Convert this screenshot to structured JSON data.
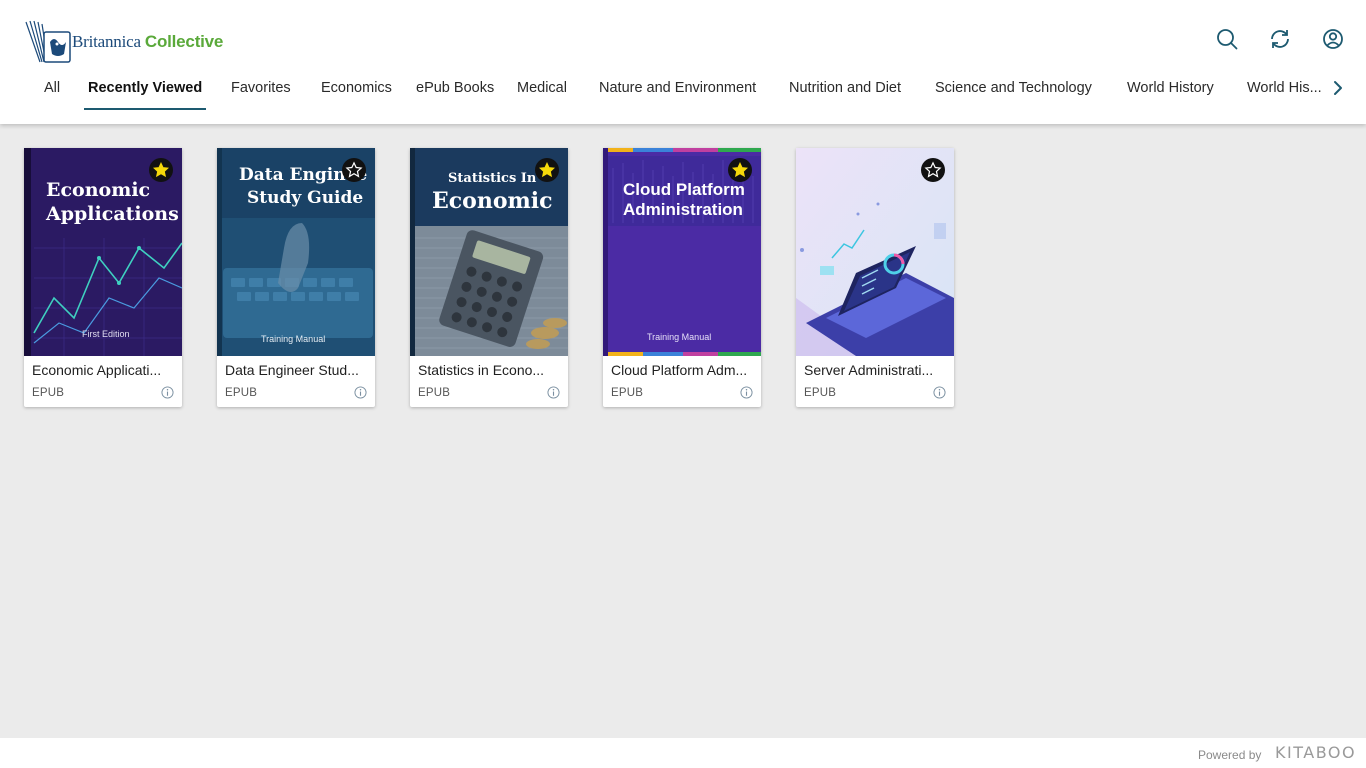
{
  "brand": {
    "name_primary": "Britannica",
    "name_accent": "Collective",
    "accent_color": "#5aa93a",
    "primary_color": "#1c4a7a"
  },
  "header_icons": [
    "search-icon",
    "refresh-icon",
    "account-icon"
  ],
  "tabs": [
    {
      "label": "All"
    },
    {
      "label": "Recently Viewed",
      "active": true
    },
    {
      "label": "Favorites"
    },
    {
      "label": "Economics"
    },
    {
      "label": "ePub Books"
    },
    {
      "label": "Medical"
    },
    {
      "label": "Nature and Environment"
    },
    {
      "label": "Nutrition and Diet"
    },
    {
      "label": "Science and Technology"
    },
    {
      "label": "World History"
    },
    {
      "label": "World His..."
    }
  ],
  "books": [
    {
      "title": "Economic Applicati...",
      "format": "EPUB",
      "favorite": true,
      "cover": {
        "line1": "Economic",
        "line2": "Applications",
        "footer": "First Edition",
        "bg": "#2b1a63"
      }
    },
    {
      "title": "Data Engineer Stud...",
      "format": "EPUB",
      "favorite": false,
      "cover": {
        "line1": "Data Enginee",
        "line2": "Study Guide",
        "footer": "Training Manual",
        "bg": "#1f4f74"
      }
    },
    {
      "title": "Statistics in Econo...",
      "format": "EPUB",
      "favorite": true,
      "cover": {
        "line1": "Statistics In",
        "line2": "Economic",
        "footer": "",
        "bg": "#1b3a5e"
      }
    },
    {
      "title": "Cloud Platform Adm...",
      "format": "EPUB",
      "favorite": true,
      "cover": {
        "line1": "Cloud Platform",
        "line2": "Administration",
        "footer": "Training Manual",
        "bg": "#4b2ba4"
      }
    },
    {
      "title": "Server Administrati...",
      "format": "EPUB",
      "favorite": false,
      "cover": {
        "line1": "",
        "line2": "",
        "footer": "",
        "bg": "#e8ddf5"
      }
    }
  ],
  "footer": {
    "powered_by": "Powered by",
    "vendor": "KITABOO"
  }
}
